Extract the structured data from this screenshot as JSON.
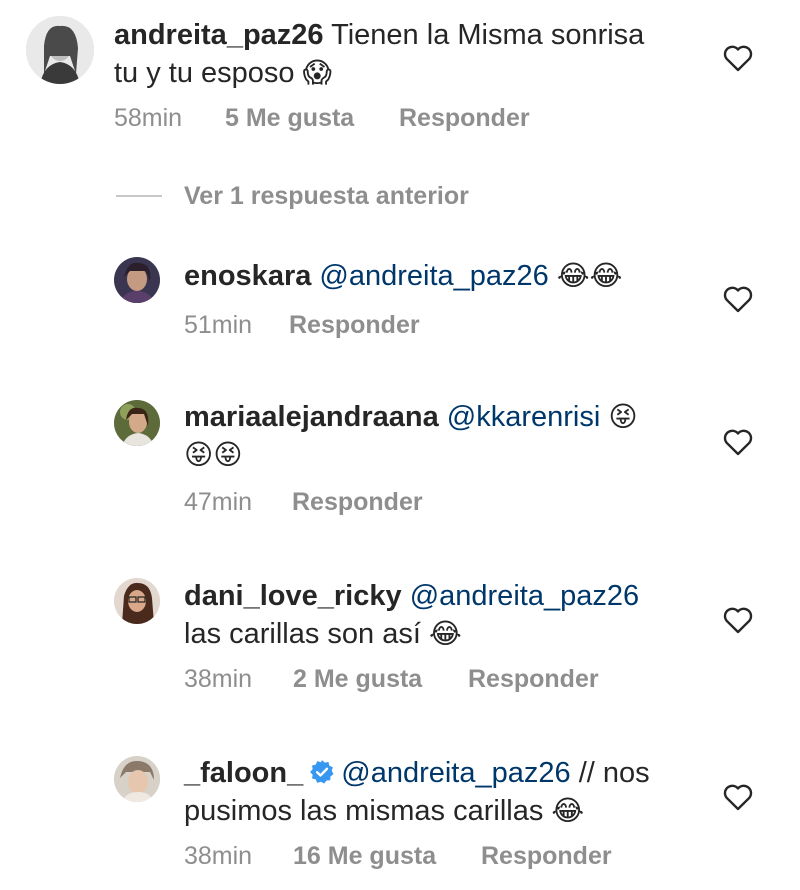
{
  "comments": [
    {
      "username": "andreita_paz26",
      "text_line1": "Tienen la Misma sonrisa",
      "text_line2": "tu y tu esposo",
      "emoji": "😱",
      "time": "58min",
      "likes": "5 Me gusta",
      "reply": "Responder"
    },
    {
      "username": "enoskara",
      "mention": "@andreita_paz26",
      "emoji": "😂😂",
      "time": "51min",
      "reply": "Responder"
    },
    {
      "username": "mariaalejandraana",
      "mention": "@kkarenrisi",
      "emoji1": "😝",
      "emoji2": "😝😝",
      "time": "47min",
      "reply": "Responder"
    },
    {
      "username": "dani_love_ricky",
      "mention": "@andreita_paz26",
      "text_line2": "las carillas son así",
      "emoji": "😂",
      "time": "38min",
      "likes": "2 Me gusta",
      "reply": "Responder"
    },
    {
      "username": "_faloon_",
      "mention": "@andreita_paz26",
      "text_line1_rest": "// nos",
      "text_line2": "pusimos las mismas carillas",
      "emoji": "😂",
      "time": "38min",
      "likes": "16 Me gusta",
      "reply": "Responder"
    }
  ],
  "view_previous": "Ver 1 respuesta anterior",
  "colors": {
    "text": "#262626",
    "meta": "#8e8e8e",
    "mention": "#00376b",
    "verified": "#3897f0"
  },
  "icons": {
    "like": "heart-outline-icon",
    "verified": "verified-badge-icon"
  }
}
